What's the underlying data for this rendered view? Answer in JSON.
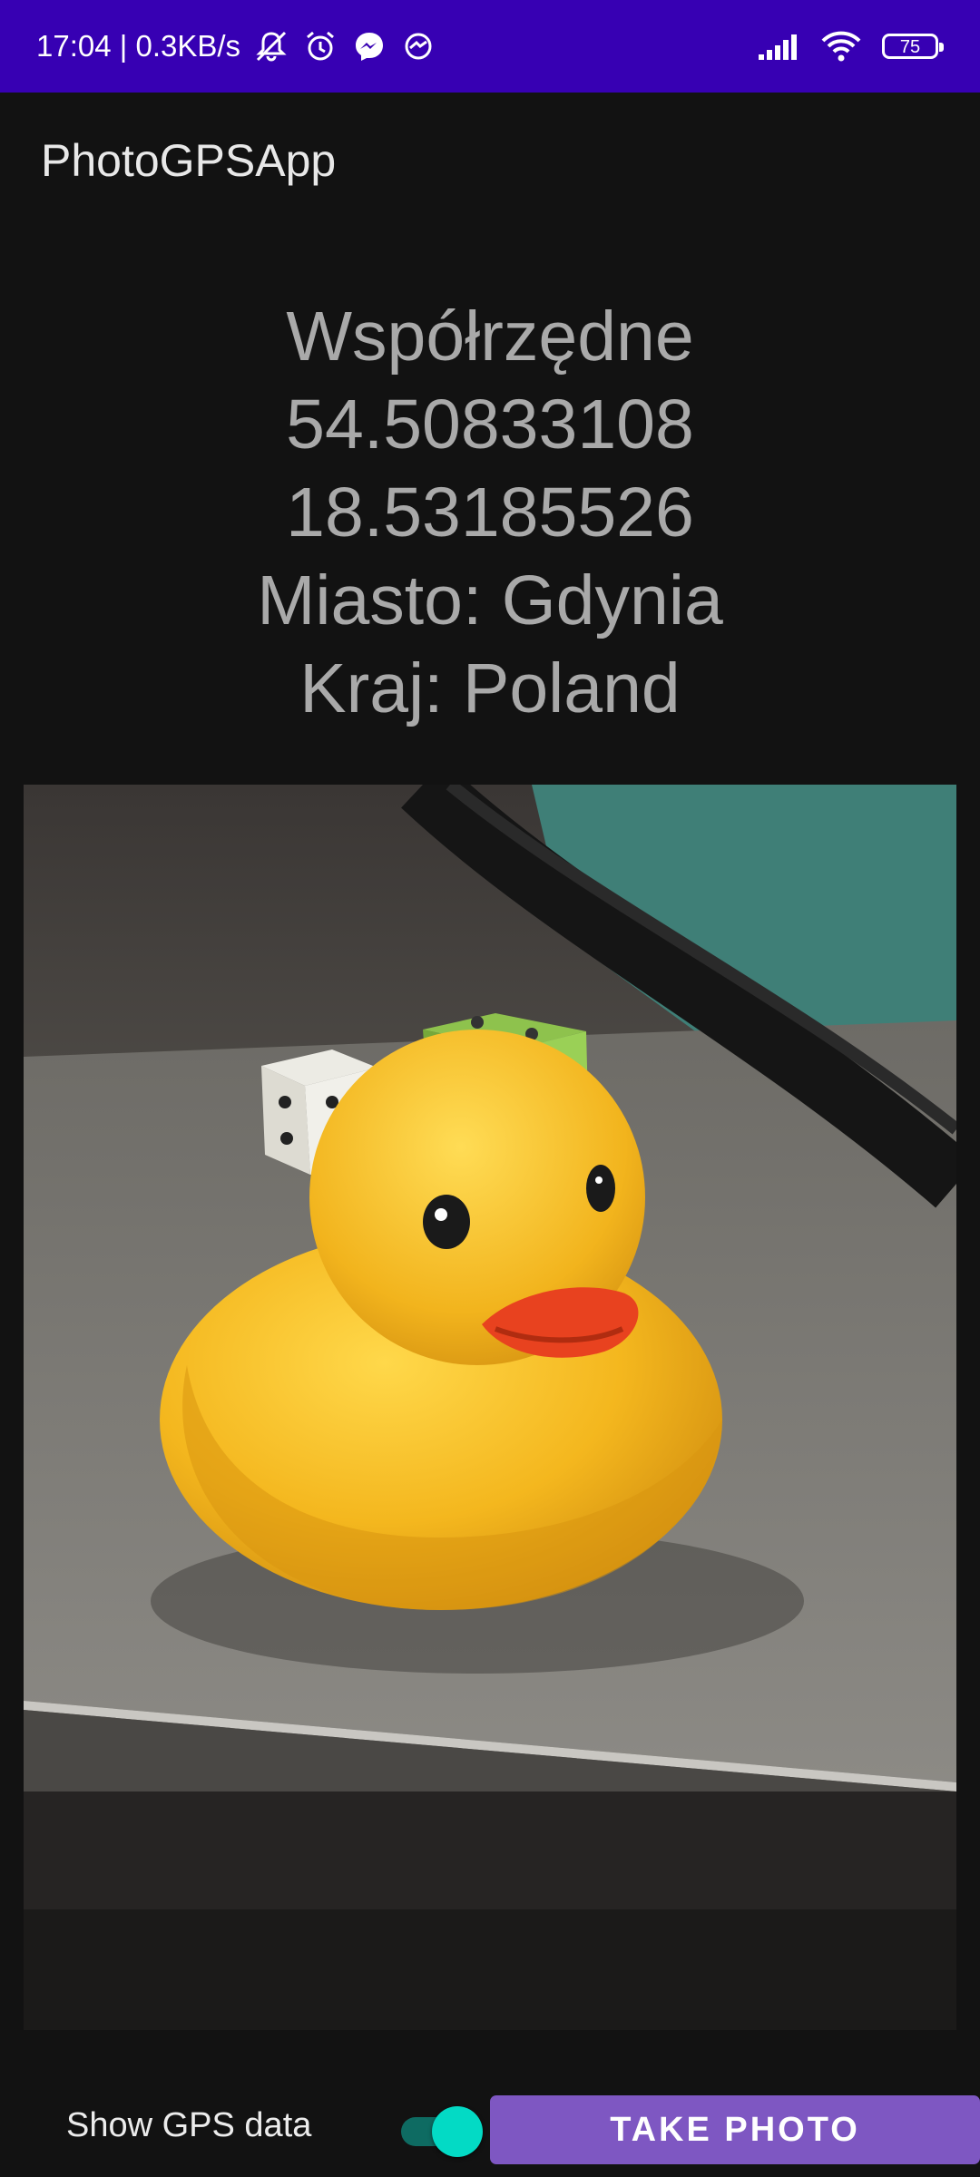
{
  "status_bar": {
    "time_speed": "17:04 | 0.3KB/s",
    "battery_level": "75",
    "icons": [
      "mute-bell-icon",
      "alarm-icon",
      "messenger-icon",
      "messenger-alt-icon",
      "signal-icon",
      "wifi-icon",
      "battery-icon"
    ]
  },
  "app_bar": {
    "title": "PhotoGPSApp"
  },
  "info": {
    "heading": "Współrzędne",
    "latitude": "54.50833108",
    "longitude": "18.53185526",
    "city": "Miasto: Gdynia",
    "country": "Kraj: Poland"
  },
  "controls": {
    "gps_label": "Show GPS data",
    "gps_toggle_on": true,
    "take_photo_label": "TAKE PHOTO"
  },
  "colors": {
    "status_bar": "#3700b3",
    "background": "#121212",
    "info_text": "#a9a9a9",
    "button": "#7e57c2",
    "switch_thumb": "#03dac5",
    "switch_track": "#0e6b62"
  }
}
